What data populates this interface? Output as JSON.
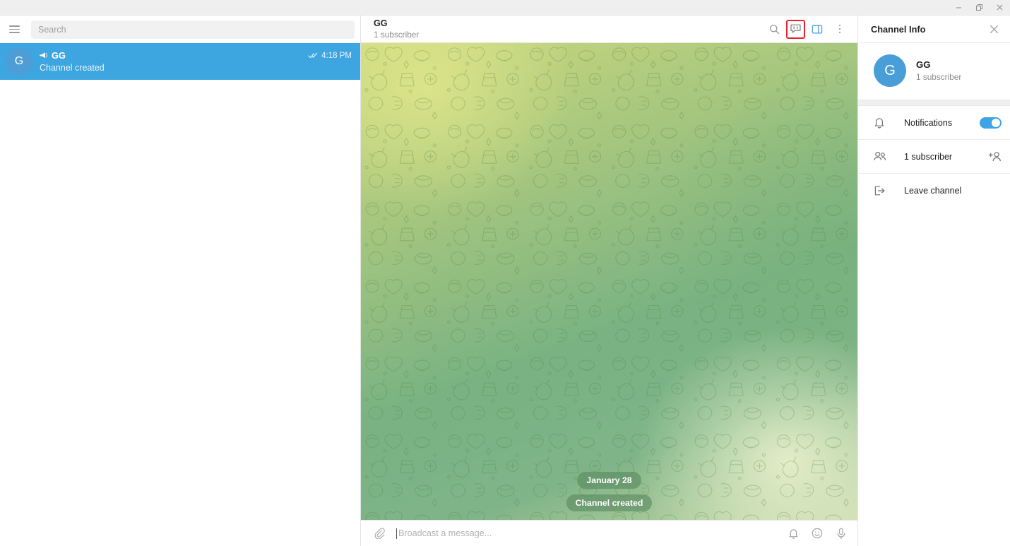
{
  "window": {
    "minimize_label": "Minimize",
    "restore_label": "Restore",
    "close_label": "Close"
  },
  "sidebar": {
    "menu_icon": "hamburger-menu-icon",
    "search": {
      "placeholder": "Search",
      "value": ""
    },
    "chats": [
      {
        "avatar_letter": "G",
        "badge_icon": "megaphone-icon",
        "name": "GG",
        "preview": "Channel created",
        "time": "4:18 PM",
        "status_icon": "double-check-icon",
        "selected": true
      }
    ]
  },
  "chat_header": {
    "title": "GG",
    "subtitle": "1 subscriber",
    "actions": [
      {
        "name": "search-icon",
        "label": "Search"
      },
      {
        "name": "discussion-icon",
        "label": "Discussion",
        "highlighted": true
      },
      {
        "name": "toggle-info-panel-icon",
        "label": "Info",
        "active": true
      },
      {
        "name": "more-options-icon",
        "label": "More"
      }
    ]
  },
  "conversation": {
    "date_divider": "January 28",
    "service_message": "Channel created"
  },
  "composer": {
    "attach_icon": "paperclip-icon",
    "placeholder": "Broadcast a message...",
    "value": "",
    "actions": [
      {
        "name": "silent-notification-icon",
        "label": "Silent"
      },
      {
        "name": "emoji-icon",
        "label": "Emoji"
      },
      {
        "name": "microphone-icon",
        "label": "Record voice"
      }
    ]
  },
  "info_panel": {
    "title": "Channel Info",
    "close_icon": "close-icon",
    "profile": {
      "avatar_letter": "G",
      "name": "GG",
      "subtitle": "1 subscriber"
    },
    "rows": [
      {
        "icon": "bell-icon",
        "label": "Notifications",
        "control": "toggle",
        "toggle_on": true
      },
      {
        "icon": "people-icon",
        "label": "1 subscriber",
        "control": "add-member-icon"
      },
      {
        "icon": "leave-icon",
        "label": "Leave channel",
        "control": "none"
      }
    ]
  },
  "colors": {
    "accent": "#3da5e0",
    "highlight": "#e8212d",
    "avatar": "#4a9ed8",
    "service_pill": "rgba(86,134,92,0.58)"
  }
}
